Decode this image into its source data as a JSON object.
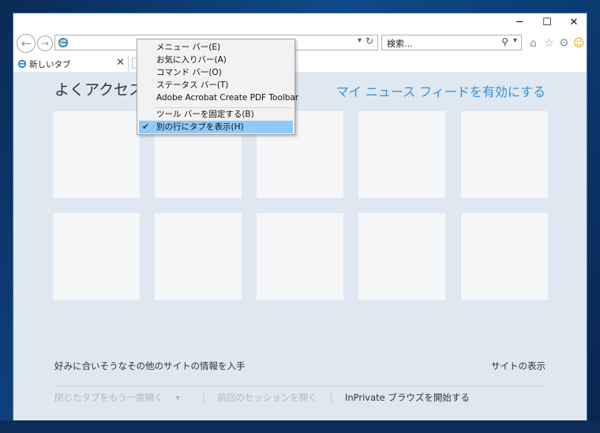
{
  "window": {
    "minimize": "─",
    "maximize": "☐",
    "close": "✕"
  },
  "toolbar": {
    "back_icon": "back-arrow-icon",
    "forward_icon": "forward-arrow-icon",
    "search_placeholder": "検索...",
    "home": "⌂",
    "favorites": "☆",
    "settings": "⚙",
    "smiley": "☺",
    "refresh": "↻",
    "dropdown": "▾",
    "search_glyph": "⚲"
  },
  "tabs": [
    {
      "label": "新しいタブ",
      "close": "✕"
    }
  ],
  "newtab_page": {
    "heading": "よくアクセスす",
    "enable_news": "マイ ニュース フィードを有効にする",
    "find_info": "好みに合いそうなその他のサイトの情報を入手",
    "show_sites": "サイトの表示",
    "reopen_closed": "閉じたタブをもう一度開く",
    "reopen_last": "前回のセッションを開く",
    "inprivate": "InPrivate ブラウズを開始する",
    "separator": "|"
  },
  "context_menu": {
    "items": [
      "メニュー バー(E)",
      "お気に入りバー(A)",
      "コマンド バー(O)",
      "ステータス バー(T)",
      "Adobe Acrobat Create PDF Toolbar",
      "ツール バーを固定する(B)",
      "別の行にタブを表示(H)"
    ],
    "checked_glyph": "✔"
  },
  "colors": {
    "accent": "#3b8fd6",
    "highlight": "#91c9f7",
    "content_bg": "#dfe8f0"
  }
}
